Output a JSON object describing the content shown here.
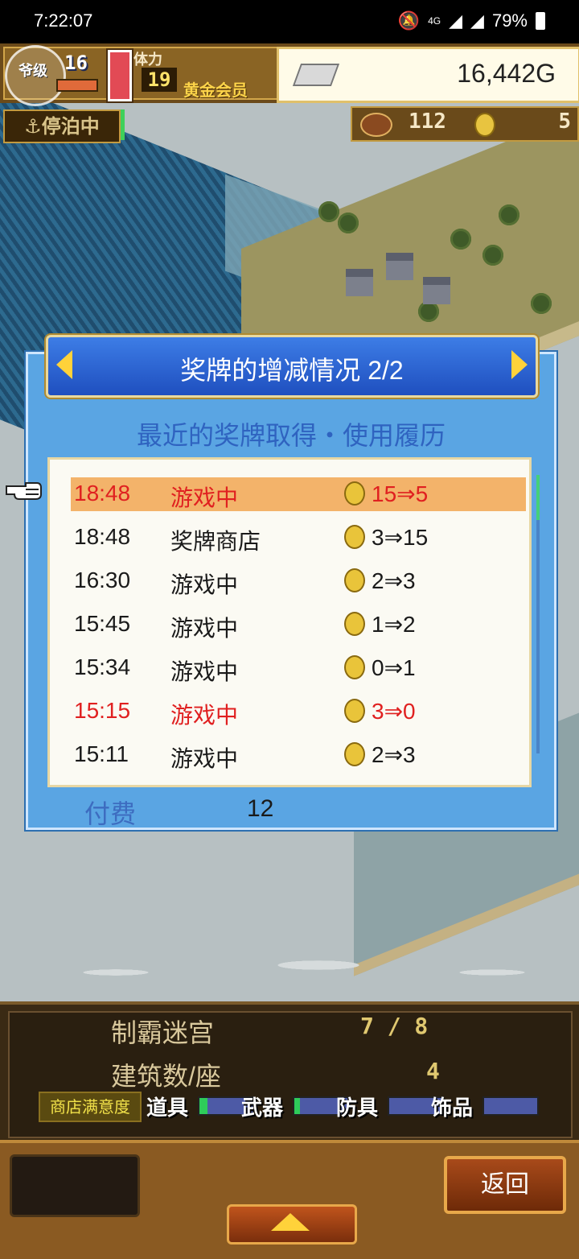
{
  "status_bar": {
    "time": "7:22:07",
    "network": "4G",
    "battery": "79%"
  },
  "hud": {
    "rank_label": "爷级",
    "level": "16",
    "stamina_label": "体力",
    "stamina_value": "19",
    "membership": "黄金会员",
    "gold": "16,442G",
    "docked_label": "停泊中",
    "resource_1": "112",
    "resource_2": "5"
  },
  "dialog": {
    "title": "奖牌的增减情况 2/2",
    "subtitle": "最近的奖牌取得・使用履历",
    "rows": [
      {
        "time": "18:48",
        "source": "游戏中",
        "change": "15⇒5"
      },
      {
        "time": "18:48",
        "source": "奖牌商店",
        "change": "3⇒15"
      },
      {
        "time": "16:30",
        "source": "游戏中",
        "change": "2⇒3"
      },
      {
        "time": "15:45",
        "source": "游戏中",
        "change": "1⇒2"
      },
      {
        "time": "15:34",
        "source": "游戏中",
        "change": "0⇒1"
      },
      {
        "time": "15:15",
        "source": "游戏中",
        "change": "3⇒0"
      },
      {
        "time": "15:11",
        "source": "游戏中",
        "change": "2⇒3"
      }
    ],
    "fee_label": "付费",
    "fee_value": "12"
  },
  "info": {
    "dungeon_label": "制霸迷宫",
    "dungeon_value": "7 / 8",
    "buildings_label": "建筑数/座",
    "buildings_value": "4",
    "satisfaction_label": "商店满意度",
    "categories": [
      {
        "label": "道具",
        "level": 0.15
      },
      {
        "label": "武器",
        "level": 0.1
      },
      {
        "label": "防具",
        "level": 0
      },
      {
        "label": "饰品",
        "level": 0
      }
    ]
  },
  "bottom": {
    "back_label": "返回"
  },
  "colors": {
    "highlight_row": "#f3b36a",
    "red_text": "#e02020",
    "dialog_blue": "#5aa5e3"
  }
}
